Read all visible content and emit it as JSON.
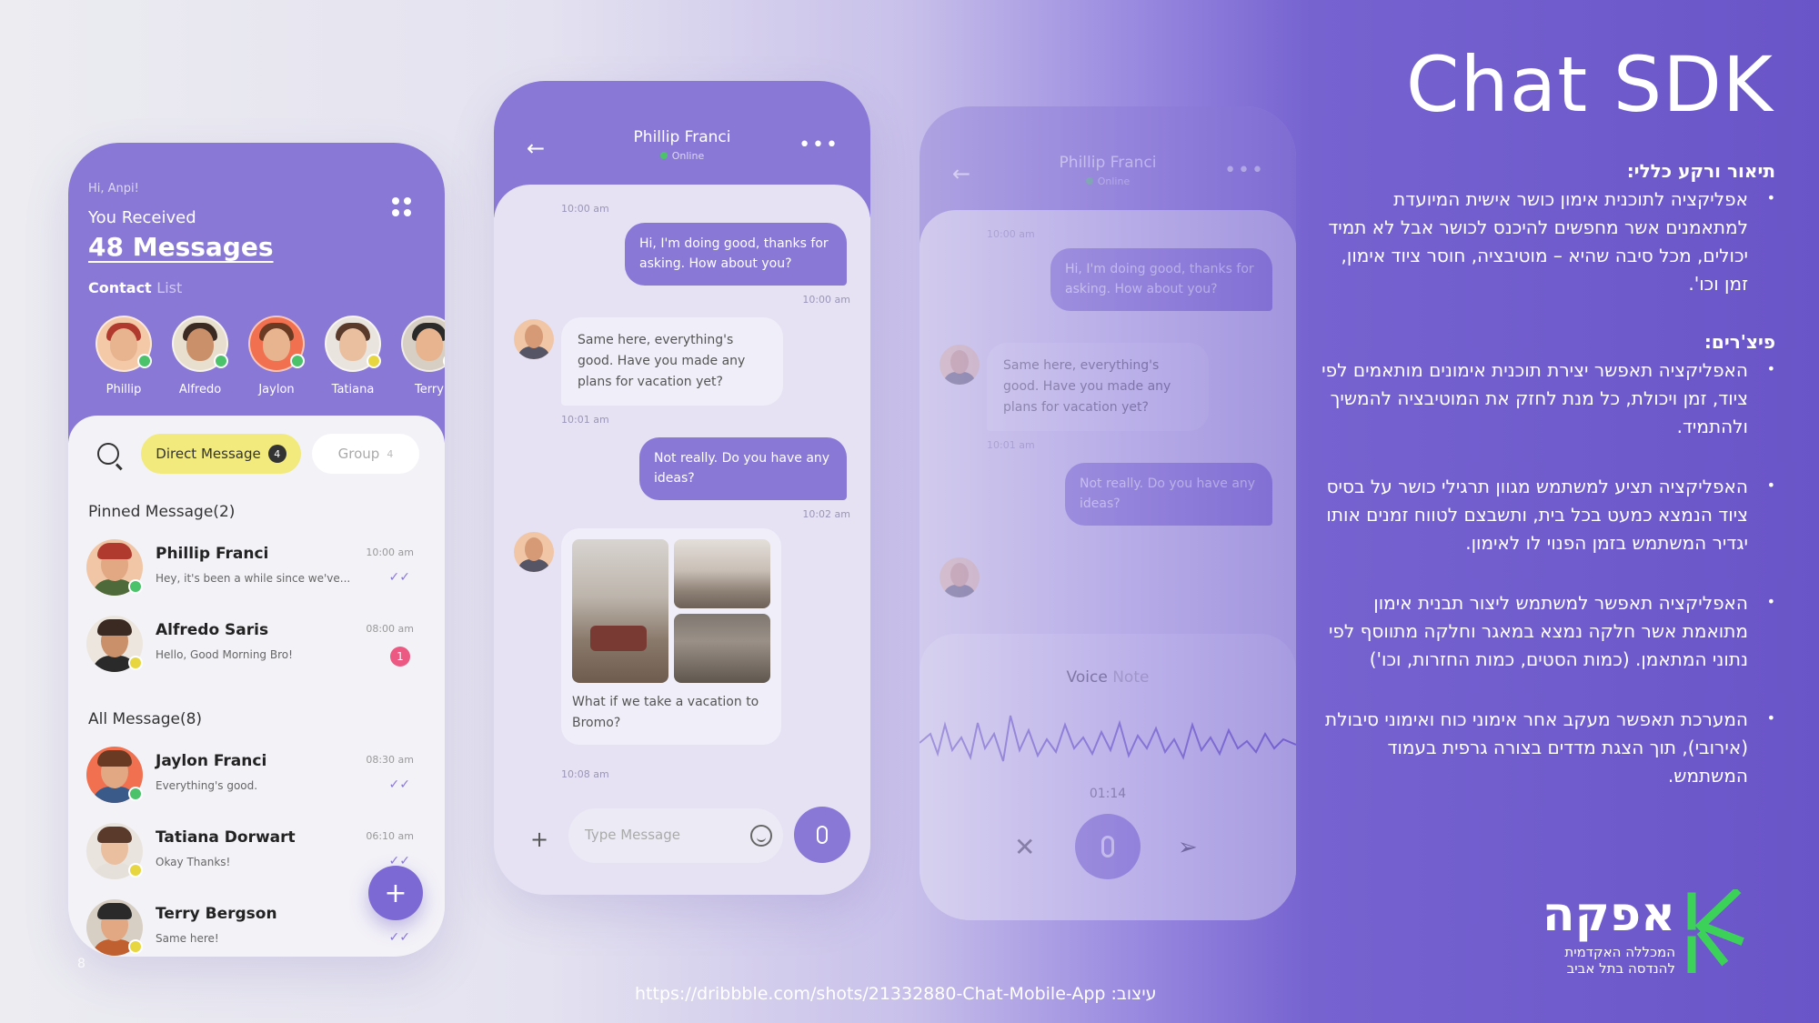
{
  "slide": {
    "title": "Chat SDK",
    "page_number": "8",
    "credit": "https://dribbble.com/shots/21332880-Chat-Mobile-App  :עיצוב",
    "background_gradient": [
      "#ececf1",
      "#6a55c8"
    ]
  },
  "description": {
    "heading": "תיאור ורקע כללי:",
    "lines": [
      "אפליקציה לתוכנית אימון כושר אישית המיועדת",
      "למתאמנים אשר מחפשים להיכנס לכושר אבל לא תמיד",
      "יכולים, מכל סיבה שהיא – מוטיבציה, חוסר ציוד אימון,",
      "זמן וכו'."
    ]
  },
  "features": {
    "heading": "פיצ'רים:",
    "items": [
      {
        "lines": [
          "האפליקציה תאפשר יצירת תוכנית אימונים מותאמים לפי",
          "ציוד, זמן ויכולת, כל מנת לחזק את המוטיבציה להמשיך",
          "ולהתמיד."
        ]
      },
      {
        "lines": [
          "האפליקציה תציע למשתמש מגוון תרגילי כושר על בסיס",
          "ציוד הנמצא כמעט בכל בית, ותשבצם לטווח זמנים אותו",
          "יגדיר המשתמש בזמן הפנוי לו לאימון."
        ]
      },
      {
        "lines": [
          "האפליקציה תאפשר למשתמש ליצור תבנית אימון",
          "מתואמת אשר חלקה נמצא במאגר וחלקה מתווסף לפי",
          "נתוני המתאמן. (כמות הסטים, כמות החזרות, וכו')"
        ]
      },
      {
        "lines": [
          "המערכת תאפשר מעקב אחר אימוני כוח ואימוני סיבולת",
          "(אירובי), תוך הצגת מדדים בצורה גרפית בעמוד",
          "המשתמש."
        ]
      }
    ]
  },
  "logo": {
    "name": "אפקה",
    "sub1": "המכללה האקדמית",
    "sub2": "להנדסה בתל אביב",
    "color": "#3cd25a"
  },
  "phone1": {
    "greeting": "Hi, Anpi!",
    "received": "You Received",
    "count": "48 Messages",
    "contact_label": "Contact",
    "contact_label2": "List",
    "contacts": [
      {
        "name": "Phillip",
        "status": "online"
      },
      {
        "name": "Alfredo",
        "status": "online"
      },
      {
        "name": "Jaylon",
        "status": "online"
      },
      {
        "name": "Tatiana",
        "status": "away"
      },
      {
        "name": "Terry",
        "status": "away"
      }
    ],
    "tab_dm": "Direct Message",
    "tab_dm_count": "4",
    "tab_group": "Group",
    "tab_group_count": "4",
    "pinned_title": "Pinned Message(2)",
    "all_title": "All Message(8)",
    "pinned": [
      {
        "name": "Phillip Franci",
        "msg": "Hey, it's been a while since we've...",
        "time": "10:00 am",
        "check": "✓✓"
      },
      {
        "name": "Alfredo Saris",
        "msg": "Hello, Good Morning Bro!",
        "time": "08:00 am",
        "unread": "1"
      }
    ],
    "all": [
      {
        "name": "Jaylon Franci",
        "msg": "Everything's good.",
        "time": "08:30 am",
        "check": "✓✓"
      },
      {
        "name": "Tatiana Dorwart",
        "msg": "Okay Thanks!",
        "time": "06:10 am",
        "check": "✓✓"
      },
      {
        "name": "Terry Bergson",
        "msg": "Same here!",
        "time": "",
        "check": "✓✓"
      }
    ],
    "fab": "+"
  },
  "phone2": {
    "name": "Phillip Franci",
    "status": "Online",
    "ts1": "10:00 am",
    "msg_out1": "Hi, I'm doing good, thanks for asking. How about you?",
    "ts2": "10:00 am",
    "msg_in1": "Same here, everything's good. Have you made any plans for vacation yet?",
    "ts3": "10:01 am",
    "msg_out2": "Not really. Do you have any ideas?",
    "ts4": "10:02 am",
    "img_caption": "What if we take a vacation to Bromo?",
    "ts5": "10:08 am",
    "input_placeholder": "Type Message",
    "plus": "+"
  },
  "phone3": {
    "name": "Phillip Franci",
    "status": "Online",
    "ts1": "10:00 am",
    "msg_out1": "Hi, I'm doing good, thanks for asking. How about you?",
    "msg_in1": "Same here, everything's good. Have you made any plans for vacation yet?",
    "ts3": "10:01 am",
    "msg_out2": "Not really. Do you have any ideas?",
    "voice_title": "Voice",
    "voice_title2": "Note",
    "voice_time": "01:14"
  }
}
